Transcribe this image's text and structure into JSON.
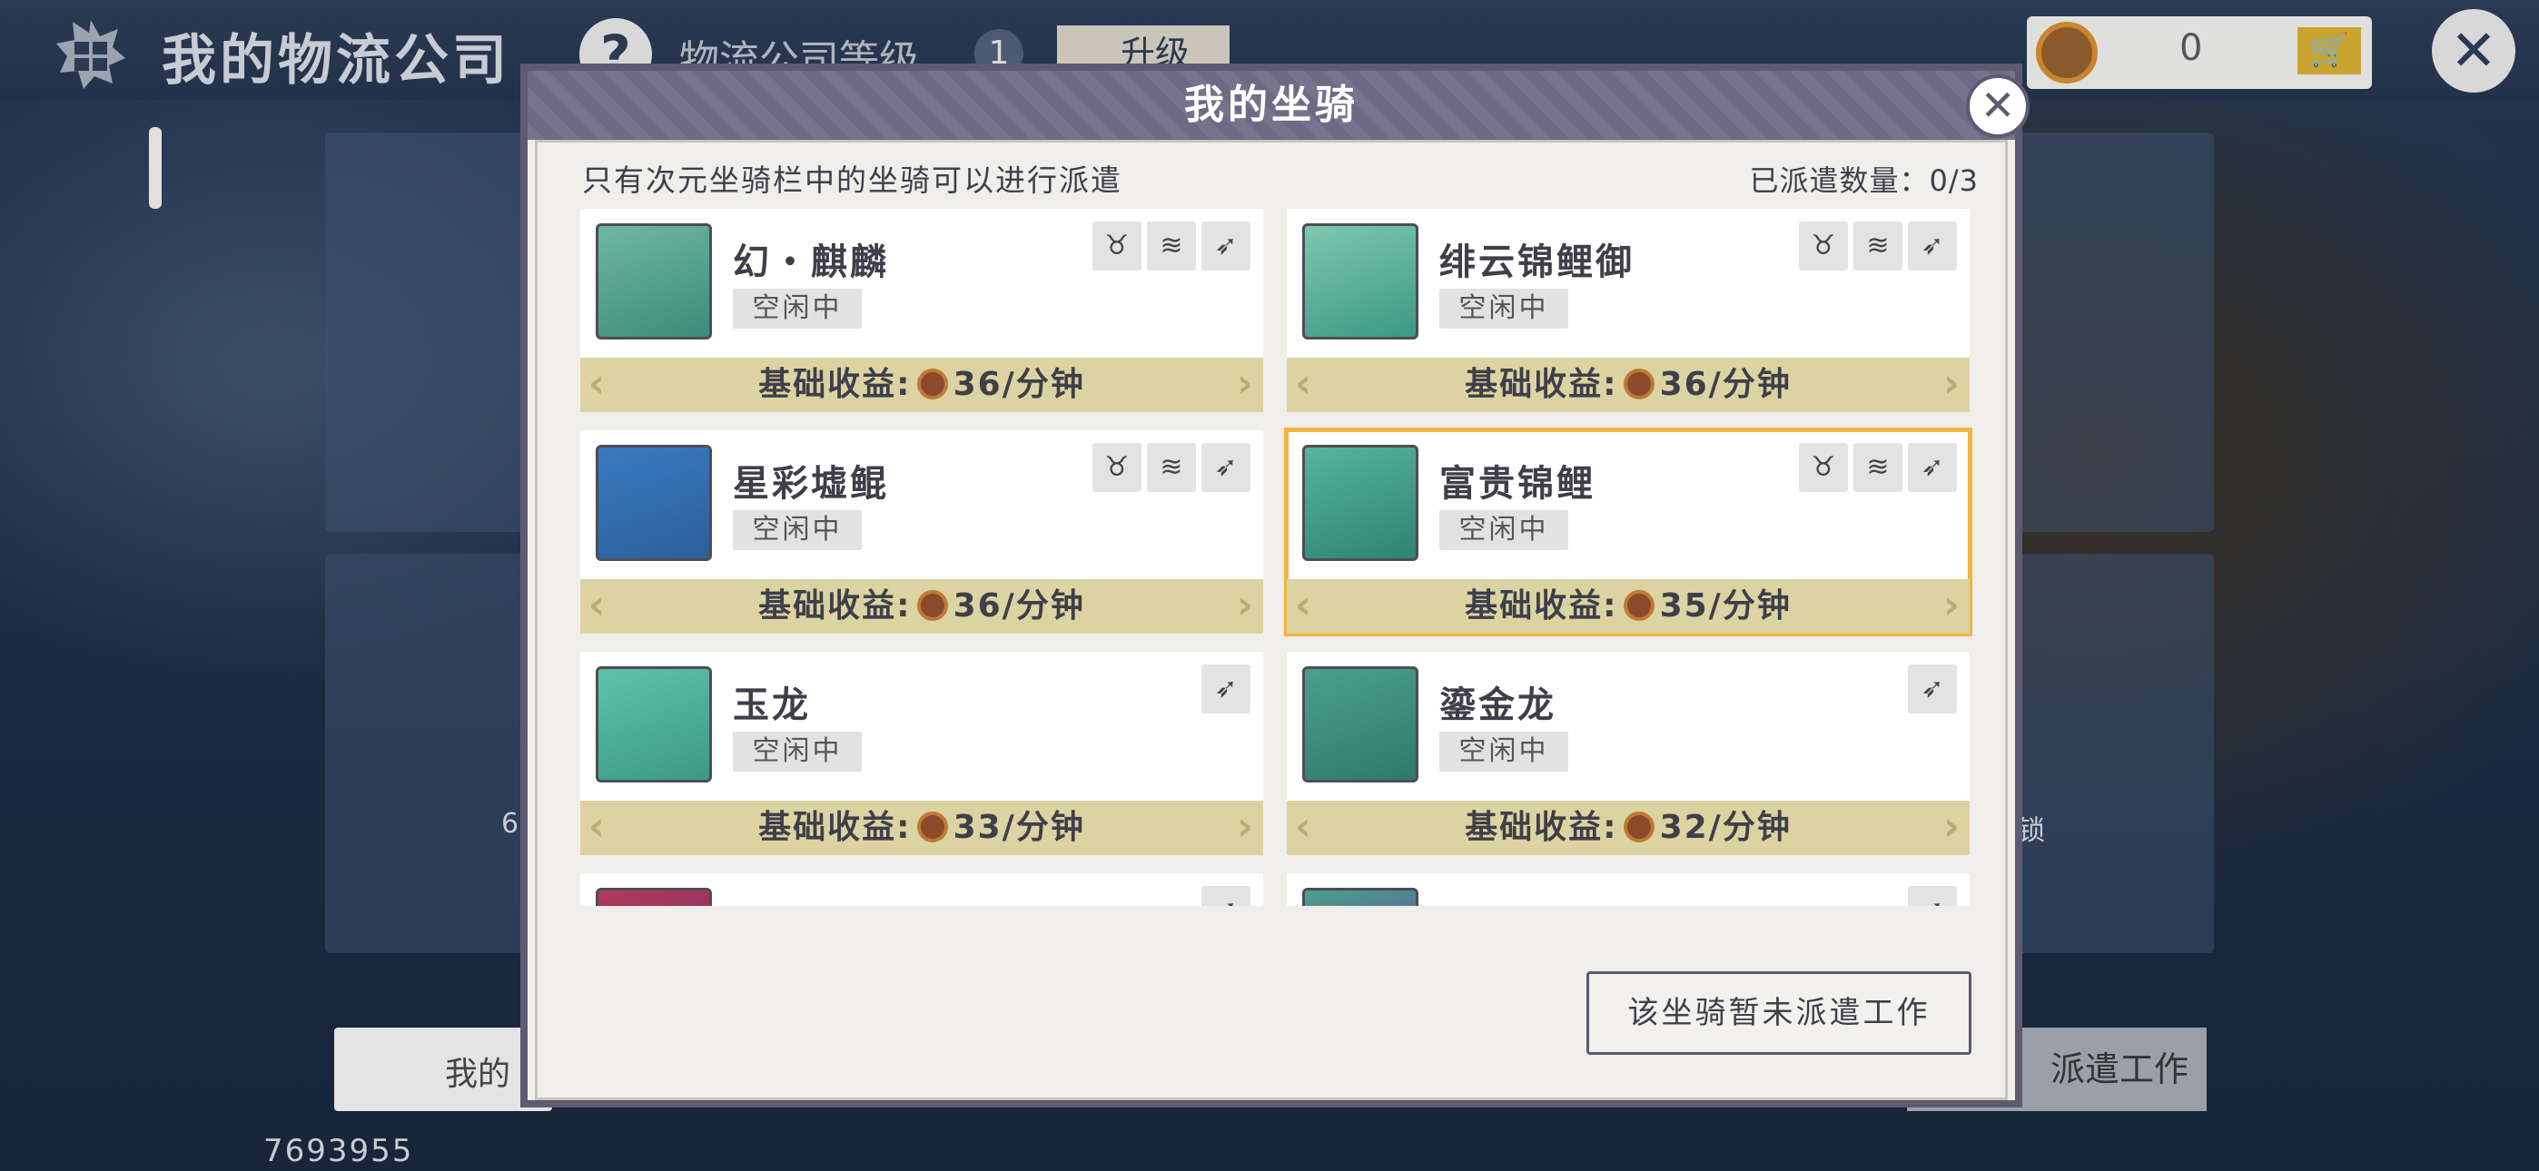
{
  "background": {
    "title": "我的物流公司",
    "help_label": "?",
    "level_label": "物流公司等级",
    "level_value": "1",
    "upgrade_label": "升级",
    "coin_value": "0",
    "close_label": "✕",
    "my_label": "我的",
    "behind_button_label": "派遣工作",
    "user_id": "7693955",
    "side_left_text": "6",
    "side_right_text": "锁"
  },
  "modal": {
    "title": "我的坐骑",
    "close_label": "✕",
    "notice": "只有次元坐骑栏中的坐骑可以进行派遣",
    "dispatch_count_label": "已派遣数量：0/3",
    "footer_button": "该坐骑暂未派遣工作",
    "income_prefix": "基础收益:",
    "mounts": [
      {
        "name": "幻・麒麟",
        "status": "空闲中",
        "income": "36/分钟",
        "tags": [
          "ground",
          "water",
          "flight"
        ],
        "selected": false
      },
      {
        "name": "绯云锦鲤御",
        "status": "空闲中",
        "income": "36/分钟",
        "tags": [
          "ground",
          "water",
          "flight"
        ],
        "selected": false
      },
      {
        "name": "星彩墟鲲",
        "status": "空闲中",
        "income": "36/分钟",
        "tags": [
          "ground",
          "water",
          "flight"
        ],
        "selected": false
      },
      {
        "name": "富贵锦鲤",
        "status": "空闲中",
        "income": "35/分钟",
        "tags": [
          "ground",
          "water",
          "flight"
        ],
        "selected": true
      },
      {
        "name": "玉龙",
        "status": "空闲中",
        "income": "33/分钟",
        "tags": [
          "flight"
        ],
        "selected": false
      },
      {
        "name": "鎏金龙",
        "status": "空闲中",
        "income": "32/分钟",
        "tags": [
          "flight"
        ],
        "selected": false
      },
      {
        "name": "",
        "status": "",
        "income": "",
        "tags": [
          "flight"
        ],
        "selected": false
      },
      {
        "name": "",
        "status": "",
        "income": "",
        "tags": [
          "flight"
        ],
        "selected": false
      }
    ]
  },
  "icons": {
    "ground": "ground-mount-icon",
    "water": "water-mount-icon",
    "flight": "flight-mount-icon"
  },
  "colors": {
    "modal_header": "#6e6a86",
    "income_bar": "#dcd3a2",
    "selected_outline": "#f0b43c",
    "portrait_bg": "#4aa08a"
  }
}
